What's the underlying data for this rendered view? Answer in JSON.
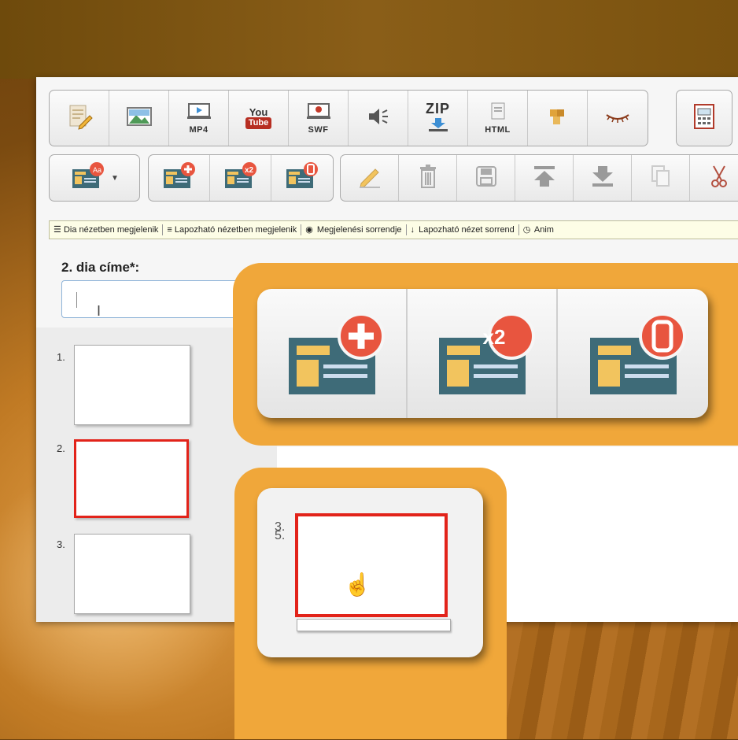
{
  "toolbar_media": {
    "mp4_label": "MP4",
    "youtube_you": "You",
    "youtube_tube": "Tube",
    "swf_label": "SWF",
    "zip_label": "ZIP",
    "html_label": "HTML"
  },
  "legend": {
    "items": [
      "Dia nézetben megjelenik",
      "Lapozható nézetben megjelenik",
      "Megjelenési sorrendje",
      "Lapozható nézet sorrend",
      "Anim"
    ]
  },
  "title_field": {
    "label": "2. dia címe*:",
    "value": ""
  },
  "slides": [
    {
      "num": "1.",
      "selected": false
    },
    {
      "num": "2.",
      "selected": true
    },
    {
      "num": "3.",
      "selected": false
    }
  ],
  "zoom_callout": {
    "drag_num_a": "3.",
    "drag_num_b": "5.",
    "badge_duplicate": "x2"
  },
  "colors": {
    "accent_orange": "#f0a73a",
    "selected_border": "#e2231a",
    "slide_icon_teal": "#3e6b78",
    "slide_icon_yellow": "#f2c45e",
    "badge_red": "#e8553f"
  }
}
